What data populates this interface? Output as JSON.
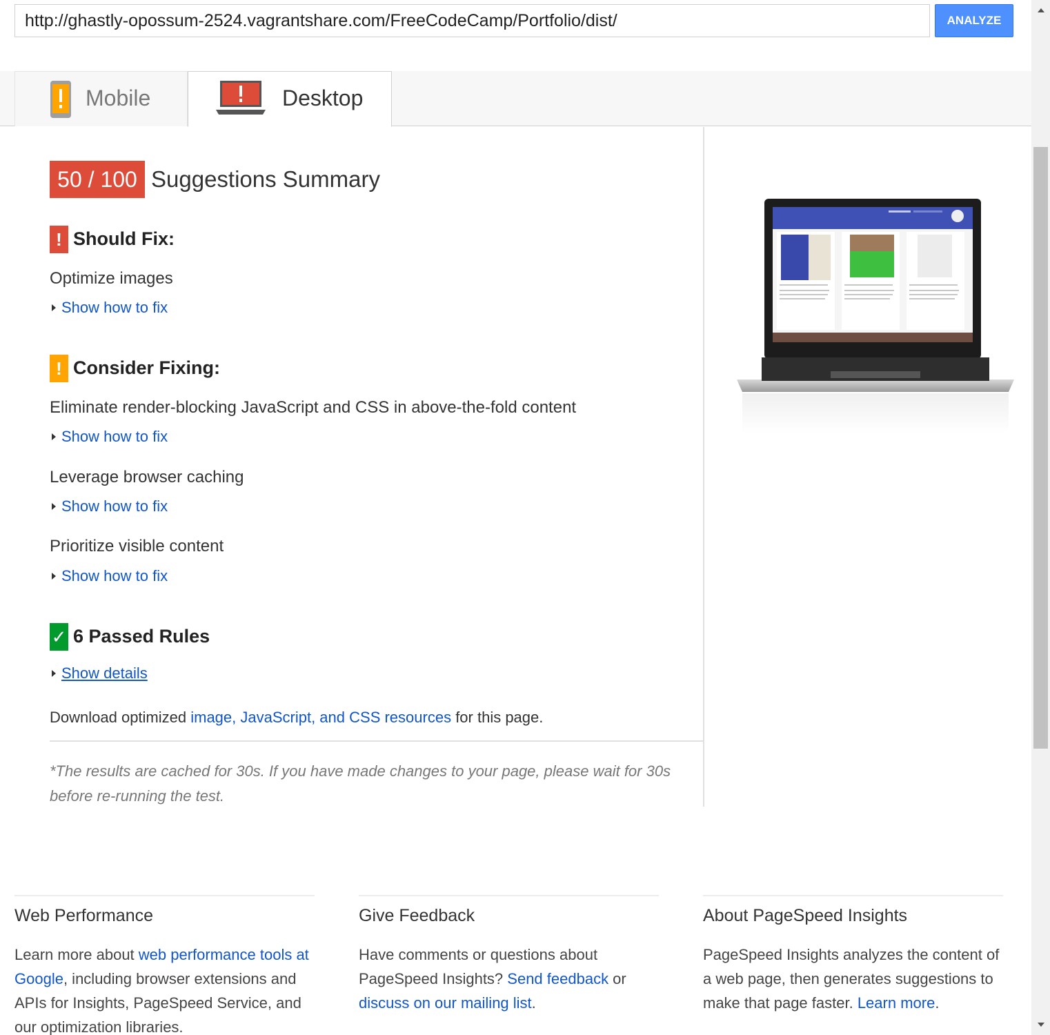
{
  "url_bar": {
    "value": "http://ghastly-opossum-2524.vagrantshare.com/FreeCodeCamp/Portfolio/dist/"
  },
  "analyze_label": "ANALYZE",
  "tabs": [
    {
      "label": "Mobile",
      "icon": "phone-warning-icon",
      "active": false
    },
    {
      "label": "Desktop",
      "icon": "laptop-warning-icon",
      "active": true
    }
  ],
  "score": {
    "value": "50 / 100",
    "color": "#dd4b39"
  },
  "summary_title": "Suggestions Summary",
  "should_fix": {
    "title": "Should Fix:",
    "icon_text": "!",
    "rules": [
      {
        "name": "Optimize images",
        "link": "Show how to fix"
      }
    ]
  },
  "consider_fixing": {
    "title": "Consider Fixing:",
    "icon_text": "!",
    "rules": [
      {
        "name": "Eliminate render-blocking JavaScript and CSS in above-the-fold content",
        "link": "Show how to fix"
      },
      {
        "name": "Leverage browser caching",
        "link": "Show how to fix"
      },
      {
        "name": "Prioritize visible content",
        "link": "Show how to fix"
      }
    ]
  },
  "passed": {
    "title": "6 Passed Rules",
    "icon_text": "✓",
    "link": "Show details"
  },
  "download": {
    "prefix": "Download optimized ",
    "link": "image, JavaScript, and CSS resources",
    "suffix": " for this page."
  },
  "cache_note": "*The results are cached for 30s. If you have made changes to your page, please wait for 30s before re-running the test.",
  "footer": [
    {
      "title": "Web Performance",
      "t1": "Learn more about ",
      "l1": "web performance tools at Google",
      "t2": ", including browser extensions and APIs for Insights, PageSpeed Service, and our optimization libraries."
    },
    {
      "title": "Give Feedback",
      "t1": "Have comments or questions about PageSpeed Insights? ",
      "l1": "Send feedback",
      "t2": " or ",
      "l2": "discuss on our mailing list",
      "t3": "."
    },
    {
      "title": "About PageSpeed Insights",
      "t1": "PageSpeed Insights analyzes the content of a web page, then generates suggestions to make that page faster. ",
      "l1": "Learn more",
      "t2": "."
    }
  ],
  "colors": {
    "link": "#1155cc",
    "accent": "#4d90fe",
    "warning": "#ffa400",
    "pass": "#009a2d"
  }
}
